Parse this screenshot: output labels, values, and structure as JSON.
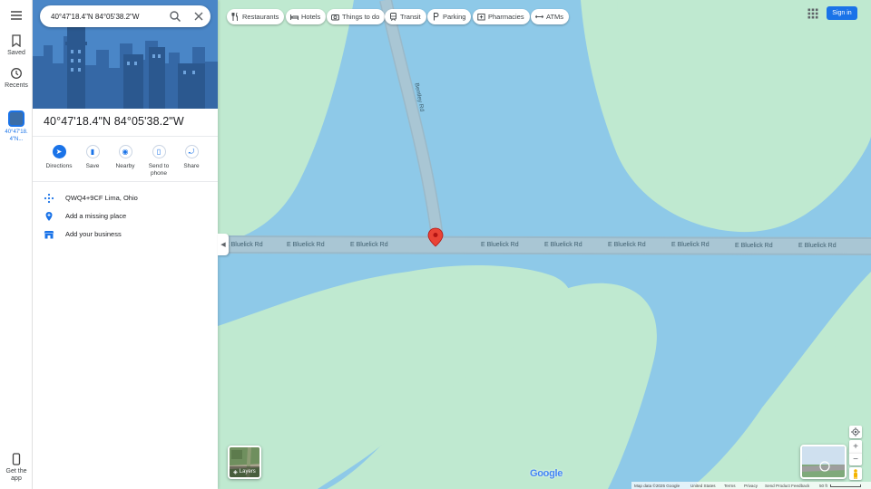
{
  "search": {
    "value": "40°47'18.4\"N 84°05'38.2\"W"
  },
  "rail": {
    "saved_label": "Saved",
    "recents_label": "Recents",
    "recent_place_label": "40°47'18.4\"N...",
    "get_app_label": "Get the app"
  },
  "place": {
    "title": "40°47'18.4\"N 84°05'38.2\"W",
    "actions": [
      {
        "label": "Directions"
      },
      {
        "label": "Save"
      },
      {
        "label": "Nearby"
      },
      {
        "label": "Send to phone"
      },
      {
        "label": "Share"
      }
    ],
    "plus_code": "QWQ4+9CF Lima, Ohio",
    "add_missing_place": "Add a missing place",
    "add_business": "Add your business"
  },
  "chips": [
    {
      "label": "Restaurants",
      "icon": "fork-knife-icon"
    },
    {
      "label": "Hotels",
      "icon": "bed-icon"
    },
    {
      "label": "Things to do",
      "icon": "camera-icon"
    },
    {
      "label": "Transit",
      "icon": "train-icon"
    },
    {
      "label": "Parking",
      "icon": "parking-icon"
    },
    {
      "label": "Pharmacies",
      "icon": "pharmacy-icon"
    },
    {
      "label": "ATMs",
      "icon": "atm-icon"
    }
  ],
  "header": {
    "sign_in_label": "Sign in"
  },
  "map": {
    "road_horizontal_label": "E Bluelick Rd",
    "road_vertical_label": "Bentley Rd",
    "layers_label": "Layers",
    "logo_text": "Google",
    "colors": {
      "land": "#bfe9d0",
      "water": "#8ec9e8",
      "road": "#9ab9c9",
      "pin": "#ea4335",
      "accent": "#1a73e8"
    }
  },
  "footer": {
    "map_data": "Map data ©2025 Google",
    "country": "United States",
    "terms": "Terms",
    "privacy": "Privacy",
    "feedback": "Send Product Feedback",
    "scale": "50 ft"
  }
}
